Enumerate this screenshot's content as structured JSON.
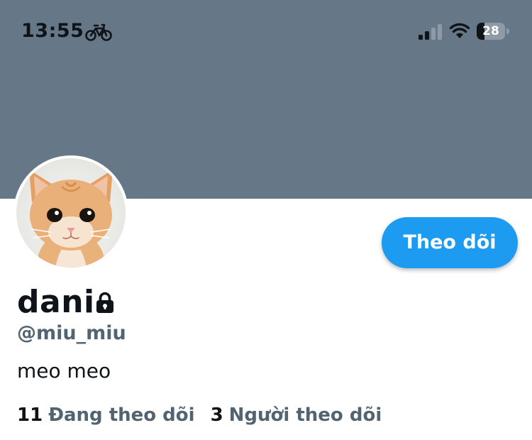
{
  "status_bar": {
    "time": "13:55",
    "battery_level": "28",
    "icons": [
      "bicycle-icon",
      "cellular-signal-icon",
      "wifi-icon",
      "battery-icon"
    ]
  },
  "colors": {
    "banner": "#667787",
    "accent": "#1d9bf0",
    "text_primary": "#0f1419",
    "text_secondary": "#536471"
  },
  "profile": {
    "display_name": "dani",
    "username": "@miu_miu",
    "bio": "meo meo",
    "protected_icon": "lock-icon",
    "avatar_icon": "kitten-avatar"
  },
  "actions": {
    "follow_label": "Theo dõi"
  },
  "stats": {
    "following_count": "11",
    "following_label": "Đang theo dõi",
    "followers_count": "3",
    "followers_label": "Người theo dõi"
  }
}
